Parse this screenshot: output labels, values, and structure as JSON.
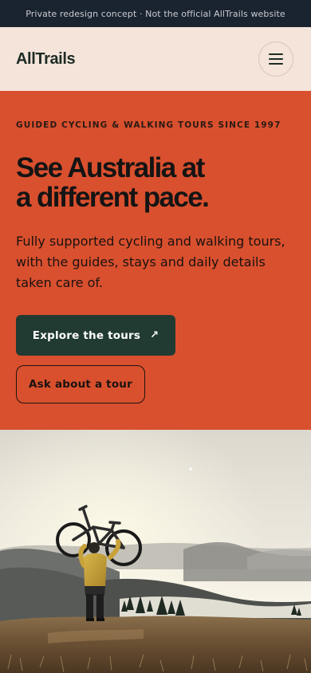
{
  "notice": {
    "text": "Private redesign concept · Not the official AllTrails website"
  },
  "header": {
    "logo": "AllTrails",
    "menu_icon": "hamburger-menu-icon"
  },
  "hero": {
    "eyebrow": "GUIDED CYCLING & WALKING TOURS SINCE 1997",
    "headline_line1": "See Australia at",
    "headline_line2": "a different pace.",
    "lead": "Fully supported cycling and walking tours, with the guides, stays and daily details taken care of.",
    "primary_cta": "Explore the tours",
    "primary_cta_icon": "arrow-up-right-icon",
    "secondary_cta": "Ask about a tour"
  },
  "colors": {
    "topbar": "#1a2330",
    "header": "#f4e4da",
    "hero": "#d9502e",
    "primary_button": "#213b32"
  }
}
